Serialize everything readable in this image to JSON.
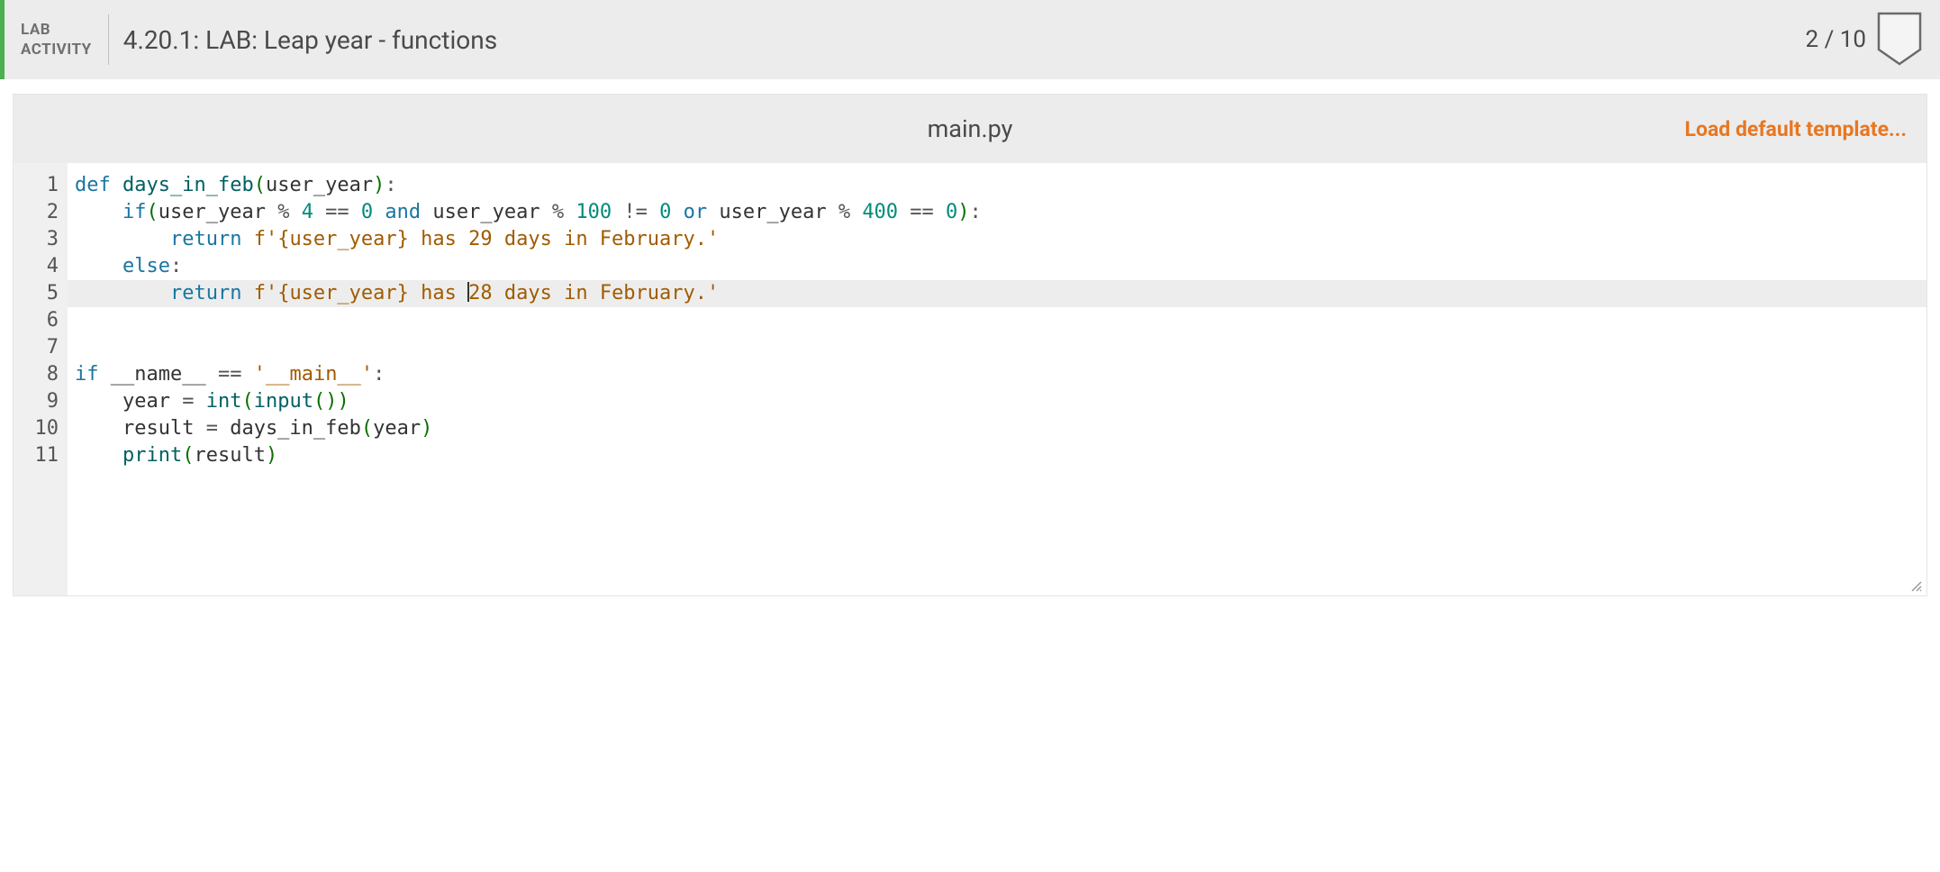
{
  "header": {
    "label_line1": "LAB",
    "label_line2": "ACTIVITY",
    "title": "4.20.1: LAB: Leap year - functions",
    "score": "2 / 10"
  },
  "file": {
    "name": "main.py",
    "load_template": "Load default template..."
  },
  "code": {
    "highlighted_line": 5,
    "line_numbers": [
      "1",
      "2",
      "3",
      "4",
      "5",
      "6",
      "7",
      "8",
      "9",
      "10",
      "11"
    ],
    "lines": [
      {
        "tokens": [
          {
            "t": "kw",
            "v": "def"
          },
          {
            "t": "sp",
            "v": " "
          },
          {
            "t": "fn",
            "v": "days_in_feb"
          },
          {
            "t": "paren",
            "v": "("
          },
          {
            "t": "ident",
            "v": "user_year"
          },
          {
            "t": "paren",
            "v": ")"
          },
          {
            "t": "op",
            "v": ":"
          }
        ]
      },
      {
        "indent": 1,
        "tokens": [
          {
            "t": "kw",
            "v": "if"
          },
          {
            "t": "paren",
            "v": "("
          },
          {
            "t": "ident",
            "v": "user_year "
          },
          {
            "t": "op",
            "v": "% "
          },
          {
            "t": "num",
            "v": "4"
          },
          {
            "t": "op",
            "v": " == "
          },
          {
            "t": "num",
            "v": "0"
          },
          {
            "t": "sp",
            "v": " "
          },
          {
            "t": "kw",
            "v": "and"
          },
          {
            "t": "sp",
            "v": " "
          },
          {
            "t": "ident",
            "v": "user_year "
          },
          {
            "t": "op",
            "v": "% "
          },
          {
            "t": "num",
            "v": "100"
          },
          {
            "t": "op",
            "v": " != "
          },
          {
            "t": "num",
            "v": "0"
          },
          {
            "t": "sp",
            "v": " "
          },
          {
            "t": "kw",
            "v": "or"
          },
          {
            "t": "sp",
            "v": " "
          },
          {
            "t": "ident",
            "v": "user_year "
          },
          {
            "t": "op",
            "v": "% "
          },
          {
            "t": "num",
            "v": "400"
          },
          {
            "t": "op",
            "v": " == "
          },
          {
            "t": "num",
            "v": "0"
          },
          {
            "t": "paren",
            "v": ")"
          },
          {
            "t": "op",
            "v": ":"
          }
        ]
      },
      {
        "indent": 2,
        "tokens": [
          {
            "t": "kw",
            "v": "return"
          },
          {
            "t": "sp",
            "v": " "
          },
          {
            "t": "str",
            "v": "f'{user_year} has 29 days in February.'"
          }
        ]
      },
      {
        "indent": 1,
        "tokens": [
          {
            "t": "kw",
            "v": "else"
          },
          {
            "t": "op",
            "v": ":"
          }
        ]
      },
      {
        "indent": 2,
        "tokens": [
          {
            "t": "kw",
            "v": "return"
          },
          {
            "t": "sp",
            "v": " "
          },
          {
            "t": "str",
            "v": "f'{user_year} has "
          },
          {
            "t": "cursor",
            "v": ""
          },
          {
            "t": "str",
            "v": "28 days in February.'"
          }
        ]
      },
      {
        "tokens": []
      },
      {
        "tokens": []
      },
      {
        "tokens": [
          {
            "t": "kw",
            "v": "if"
          },
          {
            "t": "sp",
            "v": " "
          },
          {
            "t": "ident",
            "v": "__name__ "
          },
          {
            "t": "op",
            "v": "== "
          },
          {
            "t": "str",
            "v": "'__main__'"
          },
          {
            "t": "op",
            "v": ":"
          }
        ]
      },
      {
        "indent": 1,
        "tokens": [
          {
            "t": "ident",
            "v": "year "
          },
          {
            "t": "op",
            "v": "= "
          },
          {
            "t": "fn",
            "v": "int"
          },
          {
            "t": "paren",
            "v": "("
          },
          {
            "t": "fn",
            "v": "input"
          },
          {
            "t": "paren",
            "v": "()"
          },
          {
            "t": "paren",
            "v": ")"
          }
        ]
      },
      {
        "indent": 1,
        "tokens": [
          {
            "t": "ident",
            "v": "result "
          },
          {
            "t": "op",
            "v": "= "
          },
          {
            "t": "ident",
            "v": "days_in_feb"
          },
          {
            "t": "paren",
            "v": "("
          },
          {
            "t": "ident",
            "v": "year"
          },
          {
            "t": "paren",
            "v": ")"
          }
        ]
      },
      {
        "indent": 1,
        "tokens": [
          {
            "t": "fn",
            "v": "print"
          },
          {
            "t": "paren",
            "v": "("
          },
          {
            "t": "ident",
            "v": "result"
          },
          {
            "t": "paren",
            "v": ")"
          }
        ]
      }
    ]
  }
}
